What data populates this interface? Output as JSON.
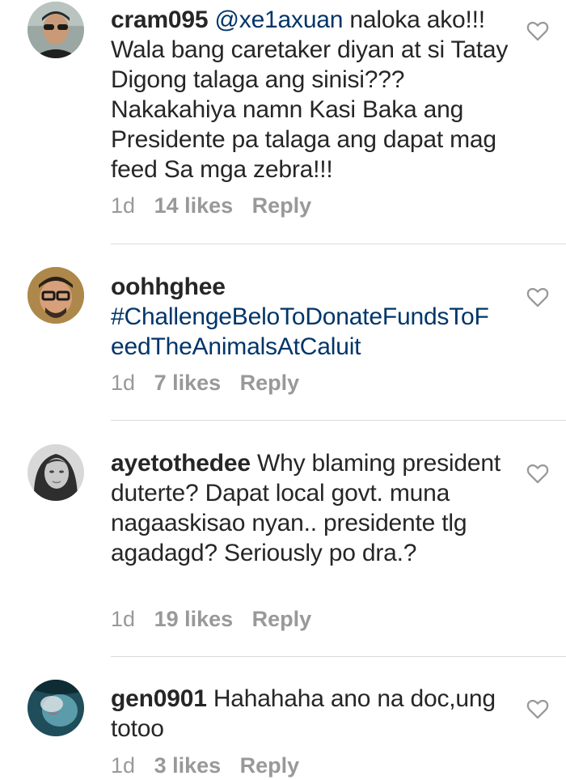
{
  "comments": [
    {
      "username": "cram095",
      "mention": "@xe1axuan",
      "text": " naloka ako!!! Wala bang caretaker diyan at si Tatay Digong talaga ang sinisi??? Nakakahiya namn Kasi Baka ang Presidente pa talaga ang dapat mag feed Sa mga zebra!!!",
      "time": "1d",
      "likes": "14 likes",
      "reply": "Reply"
    },
    {
      "username": "oohhghee",
      "hashtag_line1": "#ChallengeBeloToDonateFundsToF",
      "hashtag_line2": "eedTheAnimalsAtCaluit",
      "time": "1d",
      "likes": "7 likes",
      "reply": "Reply"
    },
    {
      "username": "ayetothedee",
      "text": " Why blaming president duterte? Dapat local govt. muna nagaaskisao nyan.. presidente tlg agadagd? Seriously po dra.?",
      "time": "1d",
      "likes": "19 likes",
      "reply": "Reply"
    },
    {
      "username": "gen0901",
      "text": " Hahahaha ano na doc,ung totoo",
      "time": "1d",
      "likes": "3 likes",
      "reply": "Reply"
    }
  ],
  "icons": {
    "like": "heart-outline-icon"
  },
  "colors": {
    "username": "#262626",
    "link": "#003569",
    "meta": "#999999",
    "divider": "#dbdbdb"
  }
}
